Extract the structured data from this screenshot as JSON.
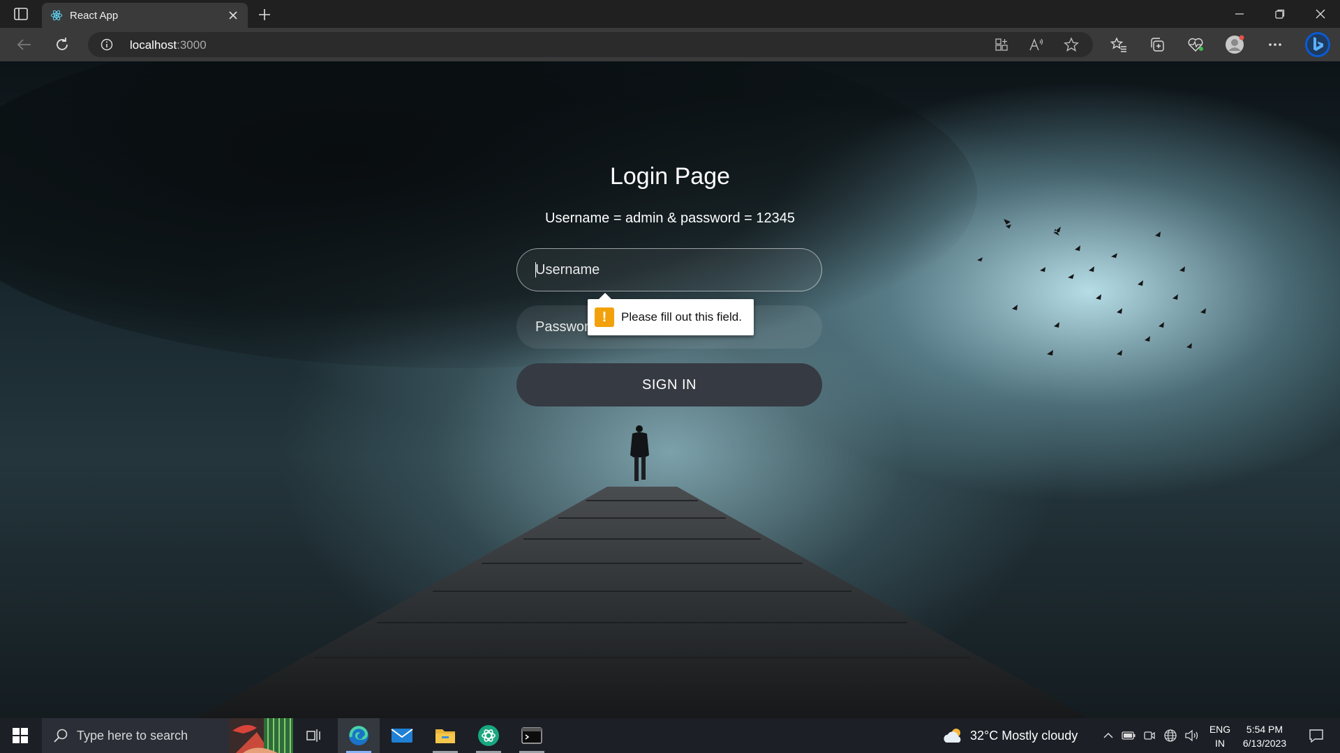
{
  "browser": {
    "tab_title": "React App",
    "url_host": "localhost",
    "url_port": ":3000"
  },
  "icons": {
    "tab_actions": "tab-actions-icon",
    "favicon": "react-logo-icon",
    "tab_close": "close-icon",
    "new_tab": "plus-icon",
    "back": "back-arrow-icon",
    "refresh": "refresh-icon",
    "site_info": "info-icon",
    "apps": "apps-icon",
    "read_aloud": "read-aloud-icon",
    "favorite": "star-icon",
    "favorites": "favorites-icon",
    "collections": "collections-icon",
    "performance": "heart-pulse-icon",
    "profile": "profile-icon",
    "more": "more-icon",
    "bing": "bing-icon"
  },
  "login": {
    "title": "Login Page",
    "hint": "Username = admin & password = 12345",
    "username_placeholder": "Username",
    "password_placeholder": "Password",
    "signin_label": "SIGN IN",
    "validation_message": "Please fill out this field."
  },
  "taskbar": {
    "search_placeholder": "Type here to search",
    "weather": "32°C  Mostly cloudy",
    "lang_line1": "ENG",
    "lang_line2": "IN",
    "time": "5:54 PM",
    "date": "6/13/2023"
  },
  "colors": {
    "tabbar_bg": "#202020",
    "navbar_bg": "#3a3a3a",
    "signin_bg": "#363a42",
    "warning": "#f2a10a",
    "taskbar_bg": "#1c1f26"
  }
}
